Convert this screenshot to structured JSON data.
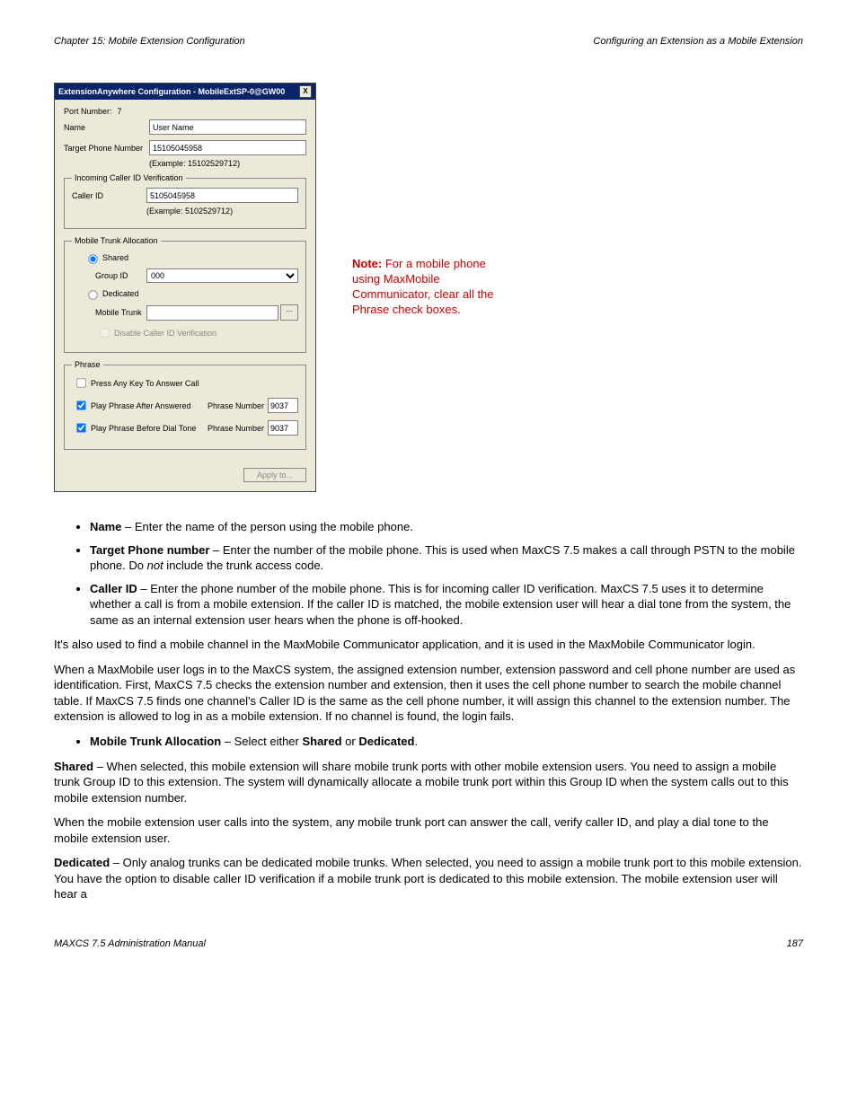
{
  "header": {
    "chapter": "Chapter 15:  Mobile Extension Configuration",
    "section": "Configuring an Extension as a Mobile Extension"
  },
  "dialog": {
    "title": "ExtensionAnywhere Configuration - MobileExtSP-0@GW00",
    "port_label": "Port Number:",
    "port_value": "7",
    "name_label": "Name",
    "name_value": "User Name",
    "target_label": "Target Phone Number",
    "target_value": "15105045958",
    "target_example": "(Example: 15102529712)",
    "caller_group": "Incoming Caller ID Verification",
    "caller_label": "Caller ID",
    "caller_value": "5105045958",
    "caller_example": "(Example: 5102529712)",
    "mta_group": "Mobile Trunk Allocation",
    "shared_label": "Shared",
    "groupid_label": "Group ID",
    "groupid_value": "000",
    "dedicated_label": "Dedicated",
    "mobiletrunk_label": "Mobile Trunk",
    "browse": "...",
    "disable_label": "Disable Caller ID Verification",
    "phrase_group": "Phrase",
    "press_label": "Press Any Key To Answer Call",
    "after_label": "Play Phrase After Answered",
    "before_label": "Play Phrase Before Dial Tone",
    "pn_label": "Phrase Number",
    "pn_after": "9037",
    "pn_before": "9037",
    "apply": "Apply to..."
  },
  "note": {
    "line1": "Note: ",
    "line2": "For a mobile phone using MaxMobile Communicator, clear all the Phrase check boxes."
  },
  "body": {
    "b1_field": "Name",
    "b1_text": " – Enter the name of the person using the mobile phone.",
    "b2_field": "Target Phone number",
    "b2_text_a": " – Enter the number of the mobile phone. This is used when MaxCS 7.5  makes a call through PSTN to the mobile phone. Do ",
    "b2_not": "not",
    "b2_text_b": " include the trunk access code.",
    "b3_field": "Caller ID",
    "b3_text": " – Enter the phone number of the mobile phone. This is for incoming caller ID verification. MaxCS 7.5  uses it to determine whether a call is from a mobile extension. If the caller ID is matched, the mobile extension user will hear a dial tone from the system, the same as an internal extension user hears when the phone is off-hooked.",
    "p2": "It's also used to find a mobile channel in the MaxMobile Communicator application, and it is used in the MaxMobile Communicator login.",
    "p3": "When a MaxMobile user logs in to the MaxCS system, the assigned extension number, extension password and cell phone number are used as identification. First, MaxCS 7.5  checks the extension number and extension, then it uses the cell phone number to search the mobile channel table. If MaxCS 7.5  finds one channel's Caller ID is the same as the cell phone number, it will assign this channel to the extension number. The extension is allowed to log in as a mobile extension. If no channel is found, the login fails.",
    "b4_field": "Mobile Trunk Allocation",
    "b4_text_a": " – Select either ",
    "b4_shared": "Shared",
    "b4_or": " or ",
    "b4_dedicated": "Dedicated",
    "b4_dot": ".",
    "b5_field": "Shared",
    "b5_text": " – When selected, this mobile extension will share mobile trunk ports with other mobile extension users. You need to assign a mobile trunk Group ID to this extension. The system will dynamically allocate a mobile trunk port within this Group ID when the system calls out to this mobile extension number.",
    "p5b": "When the mobile extension user calls into the system, any mobile trunk port can answer the call, verify caller ID, and play a dial tone to the mobile extension user.",
    "b6_field": "Dedicated",
    "b6_text": " – Only analog trunks can be dedicated mobile trunks. When selected, you need to assign a mobile trunk port to this mobile extension. You have the option to disable caller ID verification if a mobile trunk port is dedicated to this mobile extension. The mobile extension user will hear a"
  },
  "footer": {
    "left": "MAXCS 7.5 Administration Manual ",
    "right": "187"
  }
}
